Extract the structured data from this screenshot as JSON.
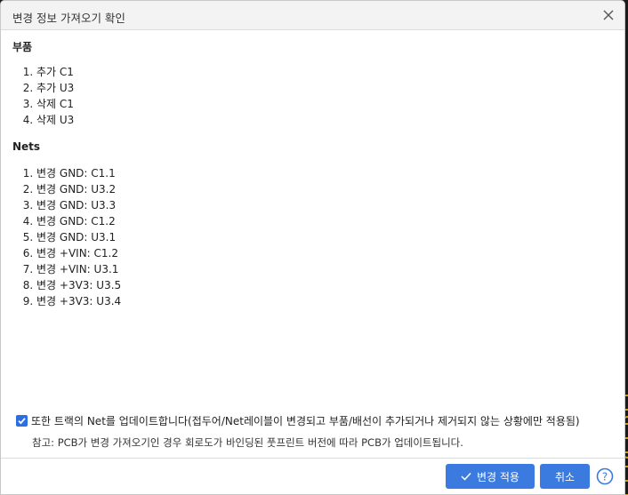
{
  "dialog": {
    "title": "변경 정보 가져오기 확인"
  },
  "sections": {
    "parts": {
      "title": "부품",
      "items": [
        "추가 C1",
        "추가 U3",
        "삭제 C1",
        "삭제 U3"
      ]
    },
    "nets": {
      "title": "Nets",
      "items": [
        "변경 GND: C1.1",
        "변경 GND: U3.2",
        "변경 GND: U3.3",
        "변경 GND: C1.2",
        "변경 GND: U3.1",
        "변경 +VIN: C1.2",
        "변경 +VIN: U3.1",
        "변경 +3V3: U3.5",
        "변경 +3V3: U3.4"
      ]
    }
  },
  "option": {
    "checked": true,
    "label": "또한 트랙의 Net를 업데이트합니다(접두어/Net레이블이 변경되고 부품/배선이 추가되거나 제거되지 않는 상황에만 적용됨)"
  },
  "note": "참고: PCB가 변경 가져오기인 경우 회로도가 바인딩된 풋프린트 버전에 따라 PCB가 업데이트됩니다.",
  "buttons": {
    "apply": "변경 적용",
    "cancel": "취소"
  },
  "colors": {
    "accent": "#3b7be0",
    "background_trace": "#c9a400"
  }
}
